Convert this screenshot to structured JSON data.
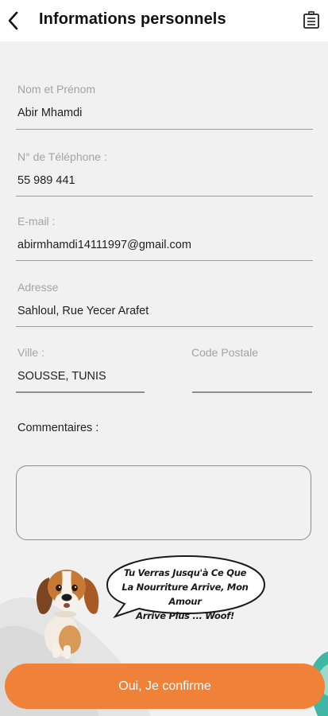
{
  "header": {
    "title": "Informations personnels",
    "back_icon": "chevron-left-icon",
    "action_icon": "document-icon"
  },
  "form": {
    "name": {
      "label": "Nom et Prénom",
      "value": "Abir Mhamdi"
    },
    "phone": {
      "label": "N° de Téléphone :",
      "value": "55 989 441"
    },
    "email": {
      "label": "E-mail :",
      "value": "abirmhamdi14111997@gmail.com"
    },
    "address": {
      "label": "Adresse",
      "value": "Sahloul, Rue Yecer Arafet"
    },
    "city": {
      "label": "Ville :",
      "value": "SOUSSE, TUNIS"
    },
    "postal_code": {
      "label": "Code Postale",
      "value": ""
    },
    "comments": {
      "label": "Commentaires :",
      "value": ""
    }
  },
  "mascot": {
    "speech_line1": "Tu Verras Jusqu'à Ce Que",
    "speech_line2": "La Nourriture Arrive, Mon Amour",
    "speech_line3": "Arrive Plus ... Woof!"
  },
  "confirm_button": {
    "label": "Oui, Je confirme"
  },
  "colors": {
    "accent": "#ef8138",
    "background": "#f1f1f1",
    "header_bg": "#ffffff",
    "label_gray": "#a3a3a3",
    "teal": "#3fb7a4"
  }
}
